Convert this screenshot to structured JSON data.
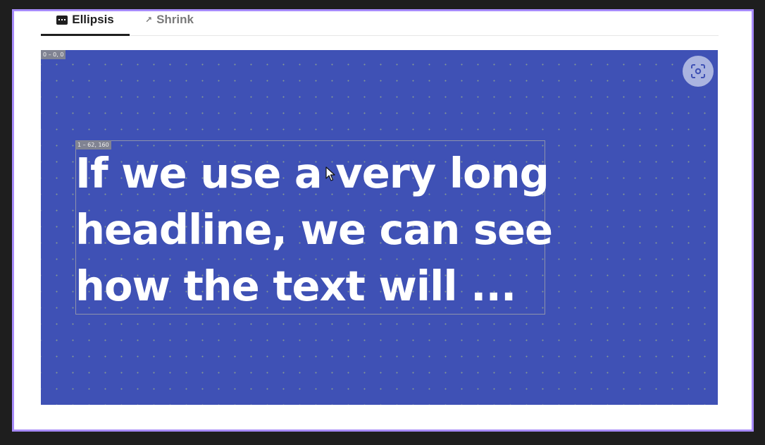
{
  "tabs": [
    {
      "label": "Ellipsis",
      "icon": "ellipsis-icon",
      "active": true
    },
    {
      "label": "Shrink",
      "icon": "shrink-icon",
      "active": false
    }
  ],
  "canvas": {
    "background_color": "#3f51b5",
    "root_tag": "0 – 0, 0",
    "text_tag": "1 – 62, 160",
    "headline": "If we use a very long\nheadline, we can see\nhow the text will ...",
    "focus_button_icon": "focus-icon"
  }
}
